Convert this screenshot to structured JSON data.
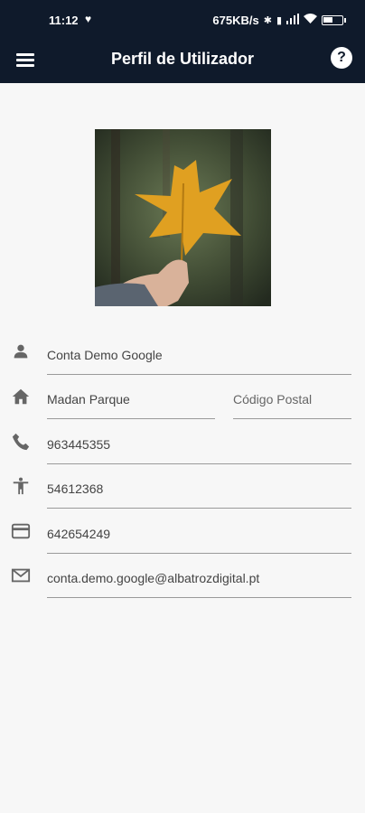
{
  "status": {
    "time": "11:12",
    "net_speed": "675KB/s",
    "battery_pct": 0.55
  },
  "appbar": {
    "title": "Perfil de Utilizador",
    "menu_icon": "hamburger-menu-icon",
    "help_icon": "help-circle-icon",
    "help_glyph": "?"
  },
  "profile": {
    "photo": "autumn-leaf-photo",
    "name": "Conta Demo Google",
    "address": "Madan Parque",
    "postal_code_placeholder": "Código Postal",
    "phone": "963445355",
    "id_number": "54612368",
    "card_number": "642654249",
    "email": "conta.demo.google@albatrozdigital.pt"
  },
  "colors": {
    "appbar_bg": "#0f1a2b",
    "page_bg": "#f7f7f7",
    "icon_color": "#666666"
  }
}
